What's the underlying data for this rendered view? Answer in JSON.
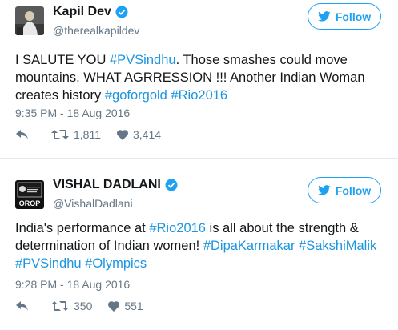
{
  "tweets": [
    {
      "display_name": "Kapil Dev",
      "handle": "@therealkapildev",
      "follow_label": "Follow",
      "text_segments": [
        {
          "t": "I SALUTE YOU ",
          "tag": false
        },
        {
          "t": "#PVSindhu",
          "tag": true
        },
        {
          "t": ". Those smashes could move mountains. WHAT AGRRESSION !!! Another Indian Woman creates history ",
          "tag": false
        },
        {
          "t": "#goforgold",
          "tag": true
        },
        {
          "t": " ",
          "tag": false
        },
        {
          "t": "#Rio2016",
          "tag": true
        }
      ],
      "timestamp": "9:35 PM - 18 Aug 2016",
      "retweets": "1,811",
      "likes": "3,414"
    },
    {
      "display_name": "VISHAL DADLANI",
      "handle": "@VishalDadlani",
      "follow_label": "Follow",
      "avatar_text": "OROP",
      "text_segments": [
        {
          "t": "India's performance at ",
          "tag": false
        },
        {
          "t": "#Rio2016",
          "tag": true
        },
        {
          "t": " is all about the strength & determination of Indian women! ",
          "tag": false
        },
        {
          "t": "#DipaKarmakar",
          "tag": true
        },
        {
          "t": " ",
          "tag": false
        },
        {
          "t": "#SakshiMalik",
          "tag": true
        },
        {
          "t": " ",
          "tag": false
        },
        {
          "t": "#PVSindhu",
          "tag": true
        },
        {
          "t": " ",
          "tag": false
        },
        {
          "t": "#Olympics",
          "tag": true
        }
      ],
      "timestamp": "9:28 PM - 18 Aug 2016",
      "retweets": "350",
      "likes": "551"
    }
  ],
  "colors": {
    "accent": "#1da1f2",
    "hashtag": "#1b95e0",
    "muted": "#657786",
    "text": "#14171a"
  },
  "icons": [
    "verified-badge-icon",
    "bird-icon",
    "reply-icon",
    "retweet-icon",
    "heart-icon"
  ]
}
